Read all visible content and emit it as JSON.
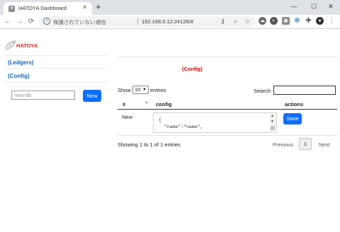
{
  "browser": {
    "tab_title": "HATOYA Dashboard",
    "tab_close": "✕",
    "new_tab": "+",
    "window_controls": {
      "minimize": "—",
      "maximize": "☐",
      "close": "✕"
    },
    "nav": {
      "back": "←",
      "forward": "→",
      "reload": "⟳"
    },
    "omnibox": {
      "security_text": "保護されていない通信",
      "url": "192.168.0.12:24126/#"
    },
    "icons": [
      "key-icon",
      "zoom-icon",
      "star-icon",
      "cloud-icon",
      "circle-icon",
      "square-icon",
      "gear-icon",
      "puzzle-icon",
      "profile-icon",
      "menu-icon"
    ]
  },
  "sidebar": {
    "brand": "HATOYA",
    "links": [
      {
        "label": "(Ledgers)"
      },
      {
        "label": "(Config)"
      }
    ],
    "new_db": {
      "placeholder": "new-db",
      "value": ""
    },
    "new_button": "New"
  },
  "main": {
    "title": "(Config)",
    "length_menu": {
      "show": "Show",
      "value": "10",
      "entries": "entries"
    },
    "search": {
      "label": "Search:",
      "value": ""
    },
    "columns": [
      "#",
      "config",
      "actions"
    ],
    "rows": [
      {
        "name": "New",
        "config": "{\n  \"name\":\"name\",",
        "action": "Save"
      }
    ],
    "info": "Showing 1 to 1 of 1 entries",
    "pagination": {
      "previous": "Previous",
      "current": "1",
      "next": "Next"
    }
  },
  "colors": {
    "brand_red": "#e0201e",
    "title_red": "#d00000",
    "link_blue": "#1565c0",
    "button_blue": "#0d6efd"
  }
}
